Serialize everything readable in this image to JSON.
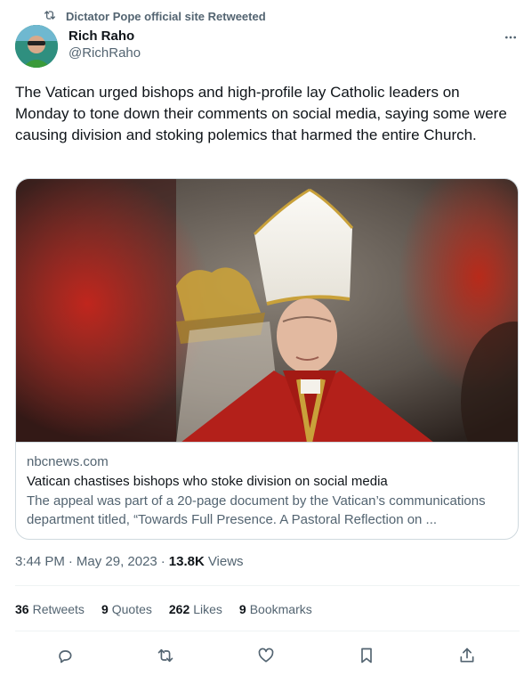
{
  "retweet_context": {
    "label": "Dictator Pope official site Retweeted",
    "icon": "retweet-icon"
  },
  "author": {
    "display_name": "Rich Raho",
    "handle": "@RichRaho"
  },
  "tweet": {
    "text": "The Vatican urged bishops and high-profile lay Catholic leaders on Monday to tone down their comments on social media, saying some were causing division and stoking polemics that harmed the entire Church."
  },
  "link_card": {
    "domain": "nbcnews.com",
    "title": "Vatican chastises bishops who stoke division on social media",
    "description": "The appeal was part of a 20-page document by the Vatican’s communications department titled, “Towards Full Presence. A Pastoral Reflection on ..."
  },
  "meta": {
    "time": "3:44 PM",
    "separator": "·",
    "date": "May 29, 2023",
    "views_count": "13.8K",
    "views_label": "Views"
  },
  "stats": [
    {
      "count": "36",
      "label": "Retweets"
    },
    {
      "count": "9",
      "label": "Quotes"
    },
    {
      "count": "262",
      "label": "Likes"
    },
    {
      "count": "9",
      "label": "Bookmarks"
    }
  ],
  "actions": [
    "reply-icon",
    "retweet-icon",
    "like-icon",
    "bookmark-icon",
    "share-icon"
  ],
  "colors": {
    "text": "#0f1419",
    "secondary": "#536471",
    "border": "#cfd9de"
  }
}
